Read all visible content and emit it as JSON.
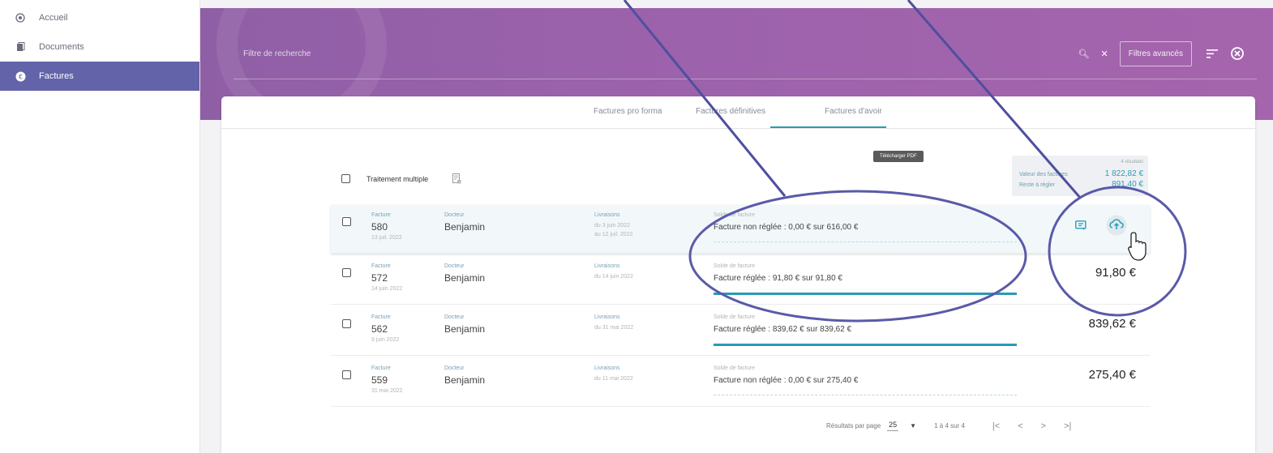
{
  "sidebar": {
    "items": [
      {
        "label": "Accueil",
        "icon": "home-circle-icon"
      },
      {
        "label": "Documents",
        "icon": "documents-icon"
      },
      {
        "label": "Factures",
        "icon": "euro-circle-icon",
        "active": true
      }
    ]
  },
  "search": {
    "placeholder": "Filtre de recherche",
    "advanced_filters": "Filtres avancés"
  },
  "tabs": [
    "Factures pro forma",
    "Factures définitives",
    "Factures d'avoir"
  ],
  "active_tab": 1,
  "multi": {
    "label": "Traitement multiple"
  },
  "summary": {
    "count": "4 résultats",
    "value_label": "Valeur des factures",
    "value": "1 822,82 €",
    "remaining_label": "Reste à régler",
    "remaining": "891,40 €"
  },
  "rows": [
    {
      "type_label": "Facture",
      "number": "580",
      "date": "13 juil. 2022",
      "doctor_label": "Docteur",
      "doctor": "Benjamin",
      "deliveries_label": "Livraisons",
      "deliveries_1": "du 3 juin 2022",
      "deliveries_2": "au 12 juil. 2022",
      "balance_label": "Solde de facture",
      "balance": "Facture non réglée : 0,00 € sur 616,00 €",
      "paid_fraction": 0,
      "amount": ""
    },
    {
      "type_label": "Facture",
      "number": "572",
      "date": "14 juin 2022",
      "doctor_label": "Docteur",
      "doctor": "Benjamin",
      "deliveries_label": "Livraisons",
      "deliveries_1": "du 14 juin 2022",
      "balance_label": "Solde de facture",
      "balance": "Facture réglée : 91,80 € sur 91,80 €",
      "paid_fraction": 1,
      "amount": "91,80 €"
    },
    {
      "type_label": "Facture",
      "number": "562",
      "date": "9 juin 2022",
      "doctor_label": "Docteur",
      "doctor": "Benjamin",
      "deliveries_label": "Livraisons",
      "deliveries_1": "du 31 mai 2022",
      "balance_label": "Solde de facture",
      "balance": "Facture réglée : 839,62 € sur 839,62 €",
      "paid_fraction": 1,
      "amount": "839,62 €"
    },
    {
      "type_label": "Facture",
      "number": "559",
      "date": "31 mai 2022",
      "doctor_label": "Docteur",
      "doctor": "Benjamin",
      "deliveries_label": "Livraisons",
      "deliveries_1": "du 11 mai 2022",
      "balance_label": "Solde de facture",
      "balance": "Facture non réglée : 0,00 € sur 275,40 €",
      "paid_fraction": 0,
      "amount": "275,40 €"
    }
  ],
  "tooltip": "Télécharger PDF",
  "pagination": {
    "per_page_label": "Résultats par page",
    "per_page": "25",
    "range": "1 à 4 sur 4"
  },
  "colors": {
    "accent": "#2a9ab5",
    "header": "#9b62ab",
    "nav_active": "#6263a8",
    "annotation": "#5a5aa8"
  }
}
